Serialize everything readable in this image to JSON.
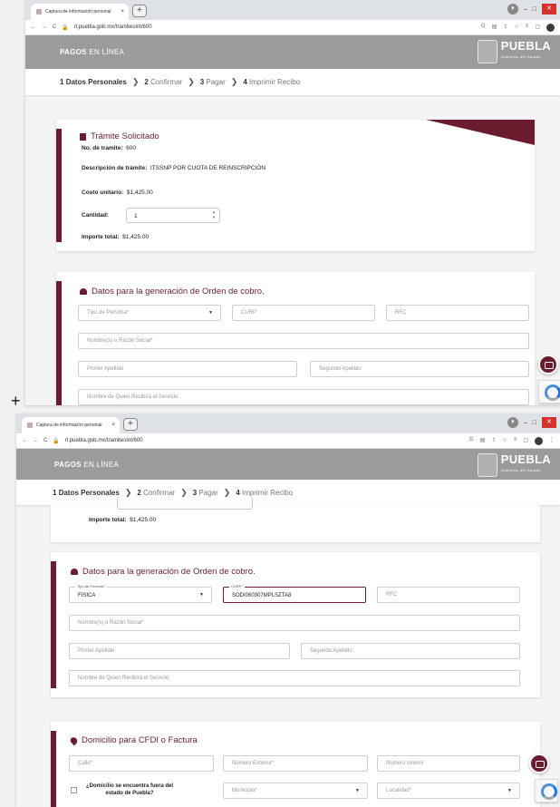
{
  "browser": {
    "tab_title": "Captura de información personal",
    "tab_close": "×",
    "new_tab": "+",
    "url": "rl.puebla.gob.mx/tramitesInt/600",
    "nav_back": "←",
    "nav_forward": "→",
    "nav_reload": "C"
  },
  "header": {
    "brand_strong": "PAGOS",
    "brand_rest": " EN LÍNEA",
    "logo_text": "PUEBLA",
    "logo_sub": "Gobierno del Estado"
  },
  "steps": [
    {
      "num": "1",
      "label": "Datos Personales"
    },
    {
      "num": "2",
      "label": "Confirmar"
    },
    {
      "num": "3",
      "label": "Pagar"
    },
    {
      "num": "4",
      "label": "Imprimir Recibo"
    }
  ],
  "tramite": {
    "title": "Trámite Solicitado",
    "num_label": "No. de tramite:",
    "num_value": "600",
    "desc_label": "Descripción de trámite:",
    "desc_value": "ITSSNP POR CUOTA DE REINSCRIPCIÓN",
    "costo_label": "Costo unitario:",
    "costo_value": "$1,425.00",
    "cantidad_label": "Cantidad:",
    "cantidad_value": "1",
    "importe_label": "Importe total:",
    "importe_value": "$1,425.00"
  },
  "orden": {
    "title": "Datos para la generación de Orden de cobro.",
    "tipo_persona_ph": "Tipo de Persona*",
    "tipo_persona_label": "Tipo de Persona*",
    "tipo_persona_value": "FISICA",
    "curp_ph": "CURP",
    "curp_label": "CURP*",
    "curp_value": "SODI060307MPLSZTA8",
    "rfc_ph": "RFC",
    "nombre_ph": "Nombre(s) o Razón Social*",
    "primer_apellido_ph": "Primer Apellido",
    "segundo_apellido_ph": "Segundo Apellido",
    "quien_recibe_ph": "Nombre de Quien Recibirá el Servicio"
  },
  "domicilio": {
    "title": "Domicilio para CFDI o Factura",
    "calle_ph": "Calle*",
    "num_ext_ph": "Número Exterior*",
    "num_int_ph": "Número Interior",
    "fuera_label_1": "¿Domicilio se encuentra fuera del",
    "fuera_label_2": "estado de Puebla?",
    "municipio_ph": "Municipio*",
    "localidad_ph": "Localidad*"
  }
}
